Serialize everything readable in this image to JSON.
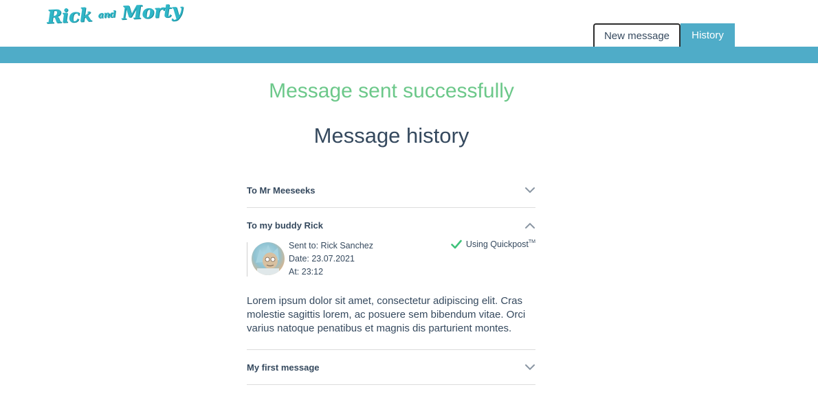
{
  "header": {
    "logo": {
      "text_main_1": "Rick",
      "text_small": "and",
      "text_main_2": "Morty"
    },
    "tabs": [
      {
        "label": "New message",
        "active": false
      },
      {
        "label": "History",
        "active": true
      }
    ]
  },
  "main": {
    "success_text": "Message sent successfully",
    "title": "Message history",
    "messages": [
      {
        "title": "To Mr Meeseeks",
        "expanded": false
      },
      {
        "title": "To my buddy Rick",
        "expanded": true,
        "sent_to": "Sent to: Rick Sanchez",
        "date": "Date: 23.07.2021",
        "time": "At: 23:12",
        "method": "Using Quickpost",
        "method_mark": "TM",
        "body": "Lorem ipsum dolor sit amet, consectetur adipiscing elit. Cras molestie sagittis lorem, ac posuere sem bibendum vitae. Orci varius natoque penatibus et magnis dis parturient montes."
      },
      {
        "title": "My first message",
        "expanded": false
      }
    ]
  },
  "colors": {
    "accent": "#4facc8",
    "success": "#6cc88a",
    "text": "#35495e",
    "logo": "#2fb6c7"
  },
  "icons": {
    "collapsed": "chevron-down-icon",
    "expanded": "chevron-up-icon",
    "check": "check-icon"
  }
}
